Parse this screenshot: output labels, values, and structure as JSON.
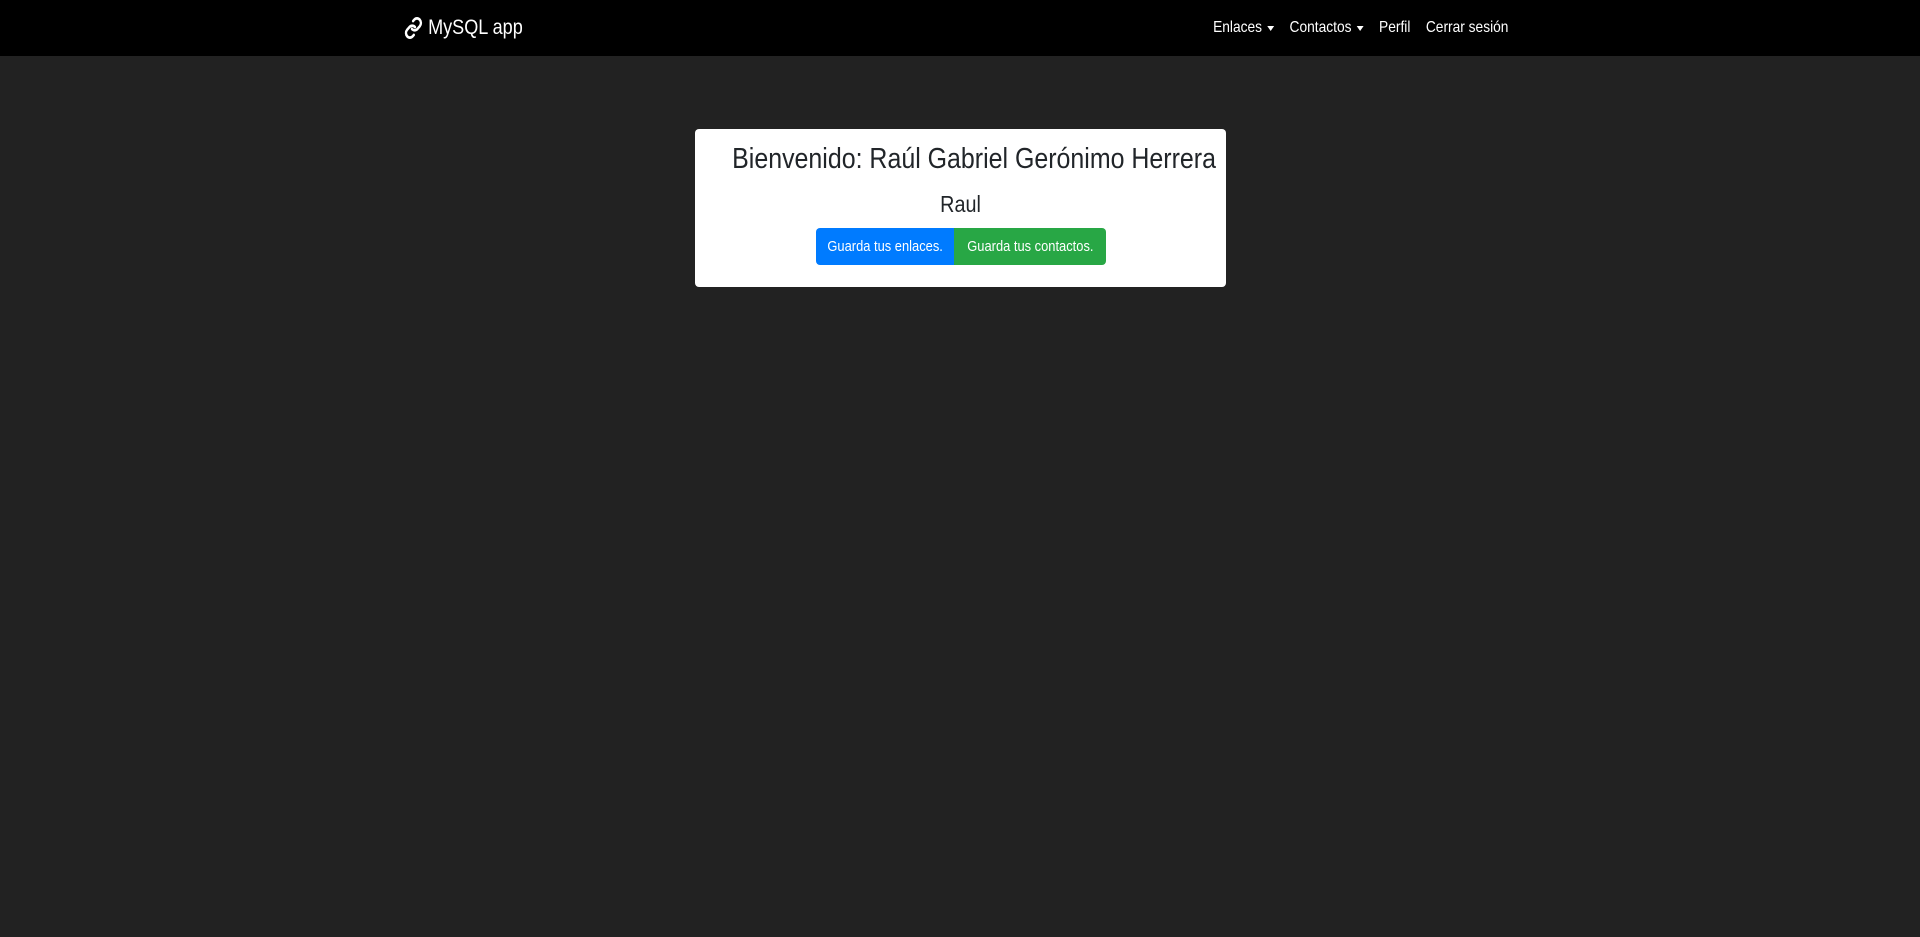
{
  "colors": {
    "background": "#222222",
    "navbar": "#000000",
    "card": "#ffffff",
    "primary": "#007bff",
    "success": "#28a745"
  },
  "navbar": {
    "brand_icon": "link-icon",
    "brand": "MySQL app",
    "links": {
      "enlaces": "Enlaces",
      "contactos": "Contactos",
      "perfil": "Perfil",
      "logout": "Cerrar sesión"
    }
  },
  "card": {
    "welcome": "Bienvenido: Raúl Gabriel Gerónimo Herrera",
    "username": "Raul",
    "buttons": {
      "links": "Guarda tus enlaces.",
      "contacts": "Guarda tus contactos."
    }
  }
}
